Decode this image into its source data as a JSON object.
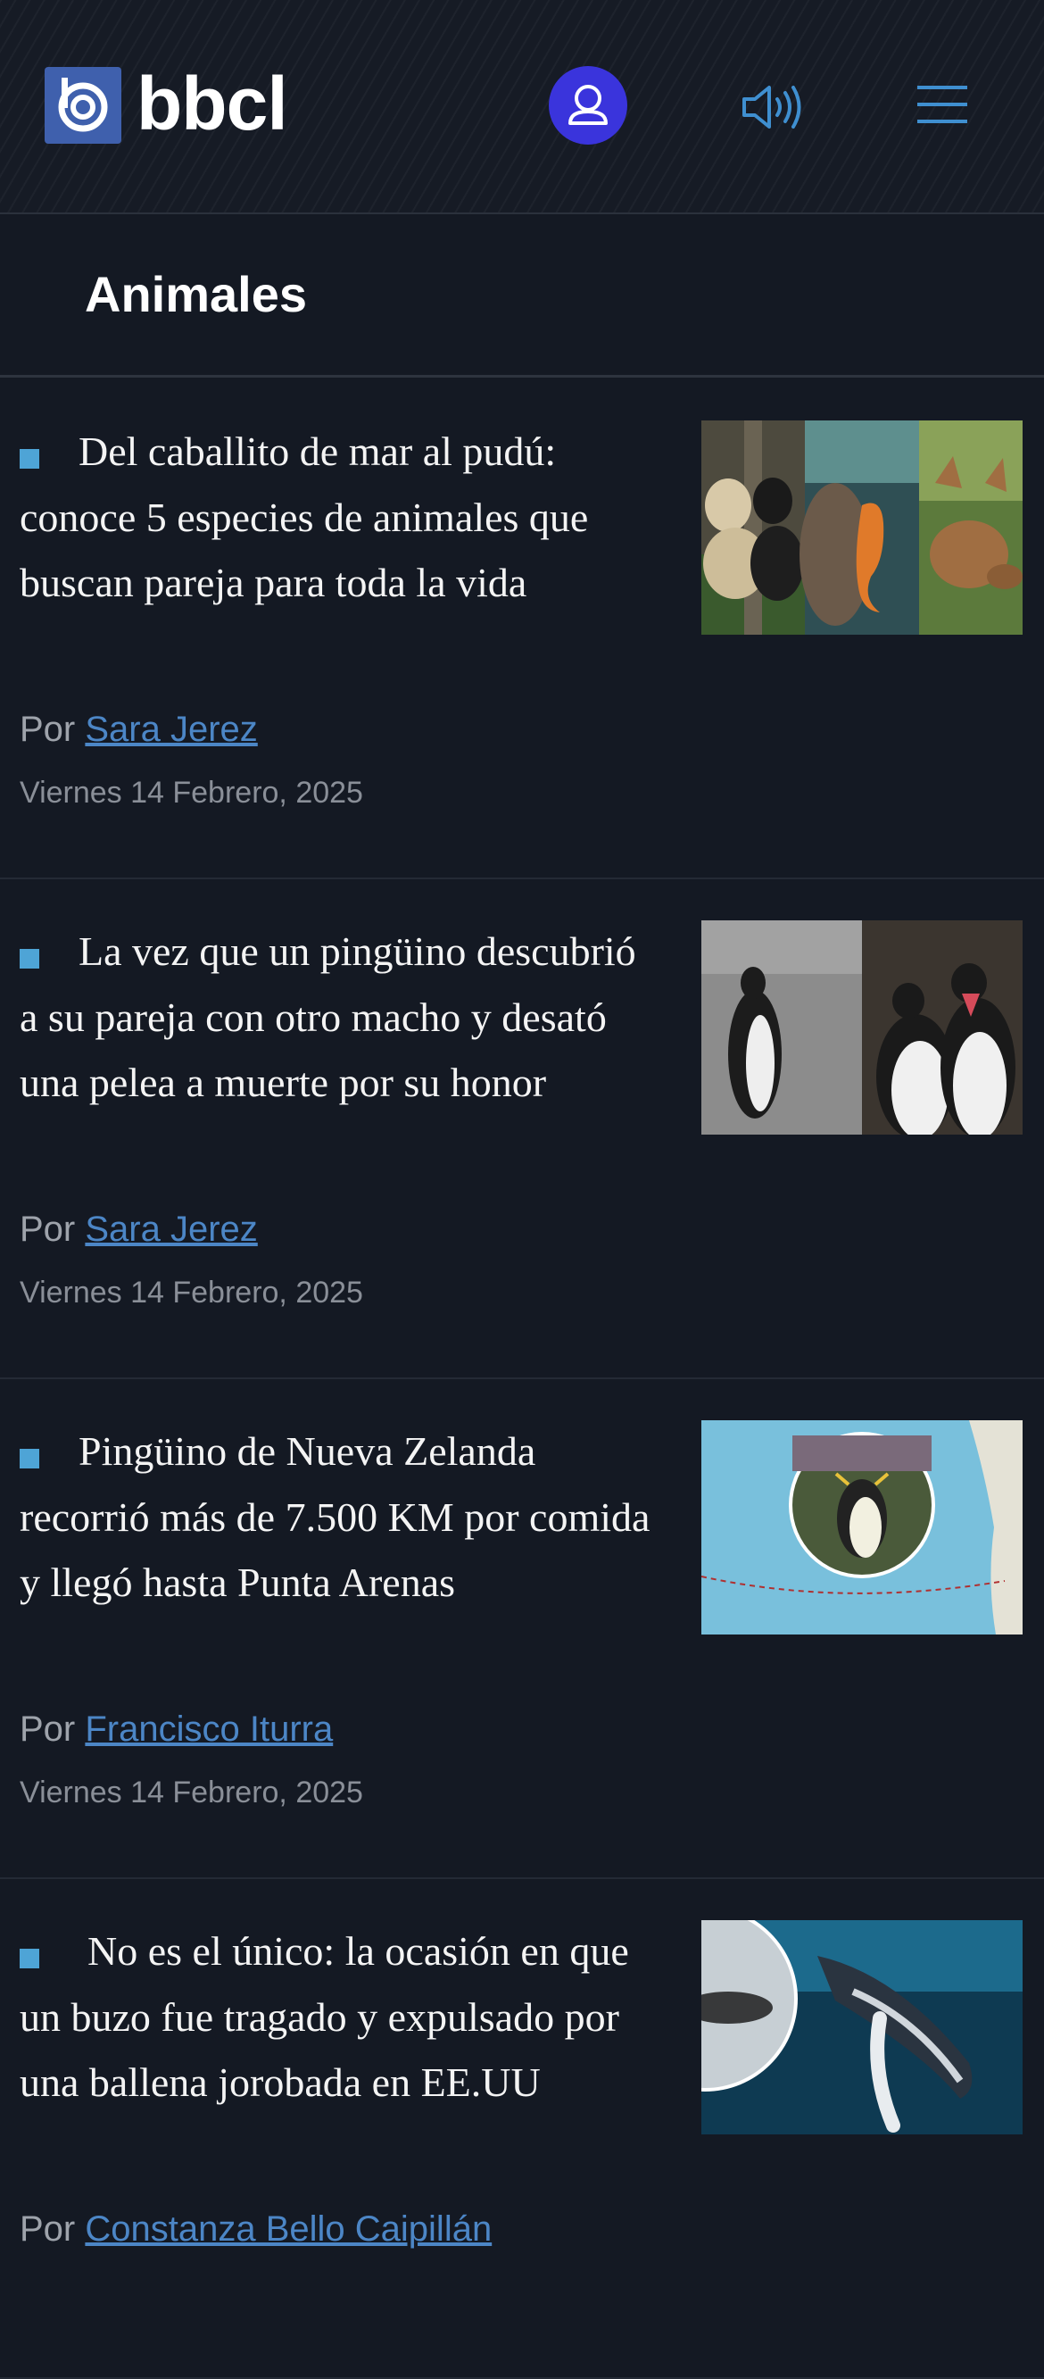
{
  "header": {
    "logo_text": "bbcl",
    "colors": {
      "logo_bg": "#3f60ad",
      "user_button": "#3a34dc",
      "accent": "#4ea4d6"
    }
  },
  "section": {
    "title": "Animales"
  },
  "byline_prefix": "Por",
  "articles": [
    {
      "headline": "Del caballito de mar al pudú: conoce 5 especies de animales que buscan pareja para toda la vida",
      "author": "Sara Jerez",
      "date": "Viernes 14 Febrero, 2025"
    },
    {
      "headline": "La vez que un pingüino descubrió a su pareja con otro macho y desató una pelea a muerte por su honor",
      "author": "Sara Jerez",
      "date": "Viernes 14 Febrero, 2025"
    },
    {
      "headline": "Pingüino de Nueva Zelanda recorrió más de 7.500 KM por comida y llegó hasta Punta Arenas",
      "author": "Francisco Iturra",
      "date": "Viernes 14 Febrero, 2025"
    },
    {
      "headline": "No es el único: la ocasión en que un buzo fue tragado y expulsado por una ballena jorobada en EE.UU",
      "author": "Constanza Bello Caipillán",
      "date": ""
    }
  ]
}
